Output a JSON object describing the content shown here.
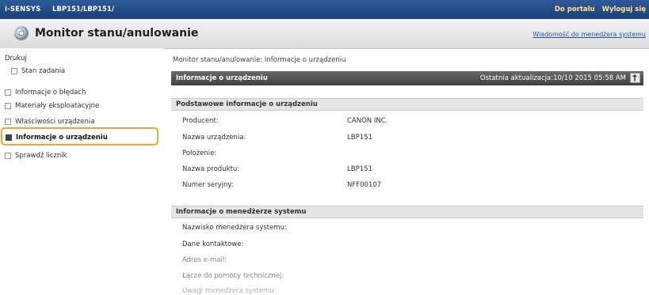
{
  "topbar": {
    "brand": "i-SENSYS",
    "model": "LBP151/LBP151/",
    "portal_link": "Do portalu",
    "logout_link": "Wyloguj się"
  },
  "titlebar": {
    "title": "Monitor stanu/anulowanie",
    "admin_message_link": "Wiadomość do menedżera systemu"
  },
  "sidebar": {
    "section": "Drukuj",
    "items": [
      {
        "label": "Stan zadania"
      },
      {
        "label": "Informacje o błędach"
      },
      {
        "label": "Materiały eksploatacyjne"
      },
      {
        "label": "Właściwości urządzenia"
      },
      {
        "label": "Informacje o urządzeniu",
        "selected": true
      },
      {
        "label": "Sprawdź licznik"
      }
    ]
  },
  "main": {
    "breadcrumb": "Monitor stanu/anulowanie: Informacje o urządzeniu",
    "panel_title": "Informacje o urządzeniu",
    "last_update_label": "Ostatnia aktualizacja:",
    "last_update_value": "10/10 2015 05:58 AM",
    "basic_section": {
      "title": "Podstawowe informacje o urządzeniu",
      "rows": [
        {
          "label": "Producent:",
          "value": "CANON INC."
        },
        {
          "label": "Nazwa urządzenia:",
          "value": "LBP151"
        },
        {
          "label": "Położenie:",
          "value": ""
        },
        {
          "label": "Nazwa produktu:",
          "value": "LBP151"
        },
        {
          "label": "Numer seryjny:",
          "value": "NFF00107"
        }
      ]
    },
    "admin_section": {
      "title": "Informacje o menedżerze systemu",
      "rows": [
        {
          "label": "Nazwisko menedżera systemu:"
        },
        {
          "label": "Dane kontaktowe:"
        },
        {
          "label": "Adres e-mail:"
        },
        {
          "label": "Łącze do pomocy technicznej:"
        },
        {
          "label": "Uwagi menedżera systemu:"
        }
      ]
    }
  },
  "colors": {
    "topbar": "#1b3f79",
    "highlight": "#f2a33a",
    "link_yellow": "#ffe680",
    "panel_header": "#4a4a4a"
  }
}
